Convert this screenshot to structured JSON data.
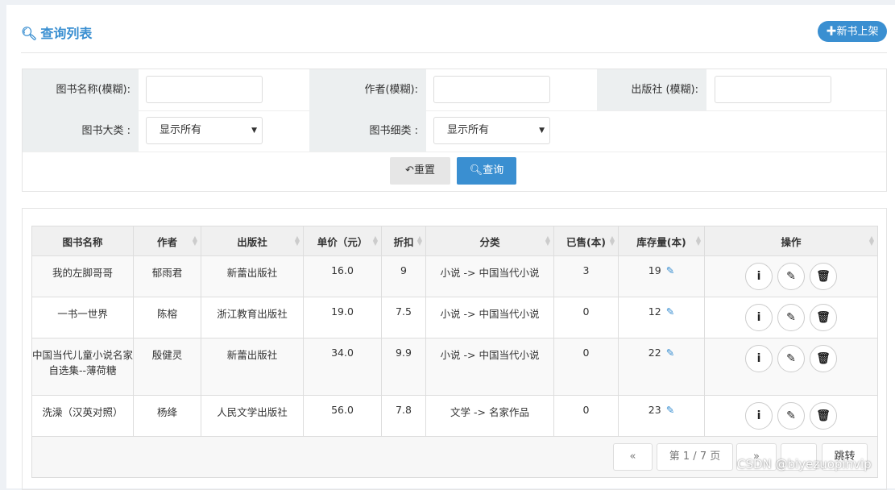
{
  "header": {
    "title": "查询列表",
    "new_book": "新书上架"
  },
  "filters": {
    "name_label": "图书名称(模糊):",
    "author_label": "作者(模糊):",
    "publisher_label": "出版社 (模糊):",
    "category_label": "图书大类 :",
    "subcategory_label": "图书细类 :",
    "category_value": "显示所有",
    "subcategory_value": "显示所有",
    "reset": "重置",
    "search": "查询"
  },
  "table": {
    "headers": [
      "图书名称",
      "作者",
      "出版社",
      "单价（元）",
      "折扣",
      "分类",
      "已售(本)",
      "库存量(本)",
      "操作"
    ],
    "rows": [
      [
        "我的左脚哥哥",
        "郁雨君",
        "新蕾出版社",
        "16.0",
        "9",
        "小说 -> 中国当代小说",
        "3",
        "19"
      ],
      [
        "一书一世界",
        "陈榕",
        "浙江教育出版社",
        "19.0",
        "7.5",
        "小说 -> 中国当代小说",
        "0",
        "12"
      ],
      [
        "中国当代儿童小说名家自选集--薄荷糖",
        "殷健灵",
        "新蕾出版社",
        "34.0",
        "9.9",
        "小说 -> 中国当代小说",
        "0",
        "22"
      ],
      [
        "洗澡（汉英对照）",
        "杨绛",
        "人民文学出版社",
        "56.0",
        "7.8",
        "文学 -> 名家作品",
        "0",
        "23"
      ]
    ]
  },
  "pagination": {
    "prev": "«",
    "page": "第 1 / 7 页",
    "next": "»",
    "jump": "跳转"
  },
  "watermark": "CSDN @biyezuopinvip"
}
